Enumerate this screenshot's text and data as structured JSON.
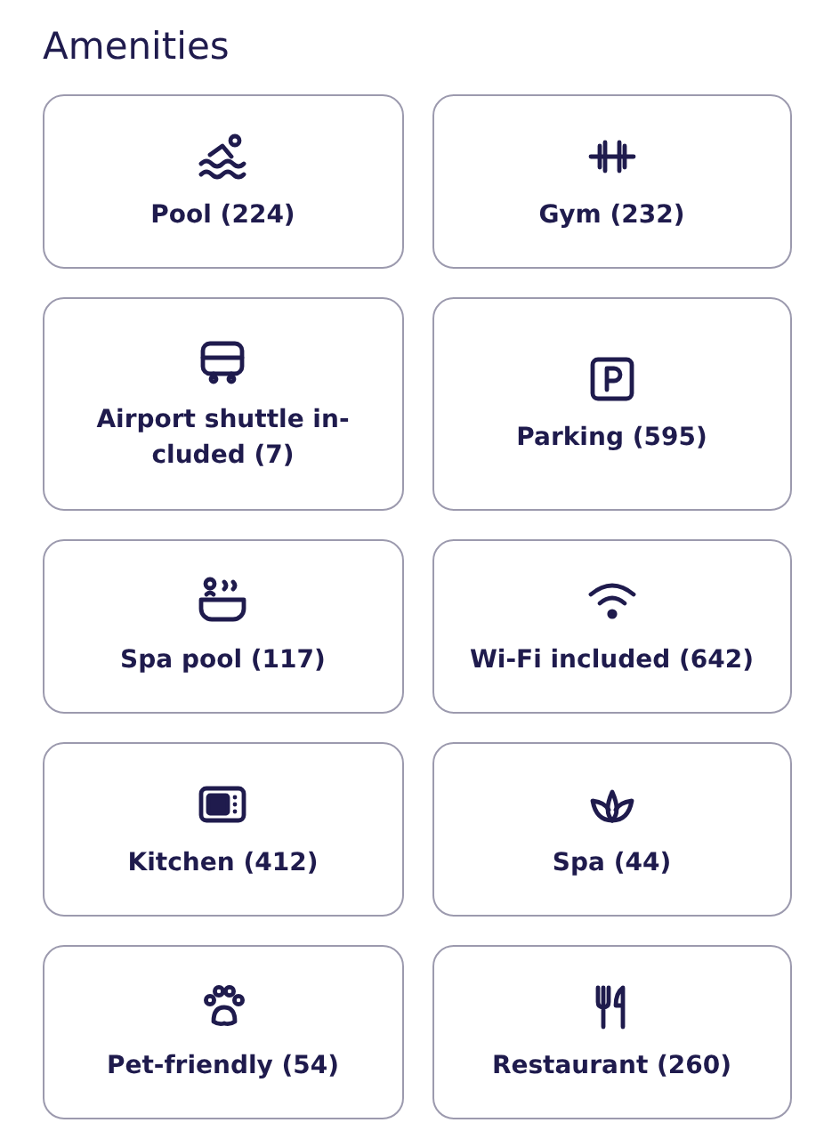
{
  "title": "Amenities",
  "amenities": [
    {
      "label": "Pool (224)"
    },
    {
      "label": "Gym (232)"
    },
    {
      "label": "Airport shuttle in-cluded (7)"
    },
    {
      "label": "Parking (595)"
    },
    {
      "label": "Spa pool (117)"
    },
    {
      "label": "Wi-Fi included (642)"
    },
    {
      "label": "Kitchen (412)"
    },
    {
      "label": "Spa (44)"
    },
    {
      "label": "Pet-friendly (54)"
    },
    {
      "label": "Restaurant (260)"
    }
  ]
}
